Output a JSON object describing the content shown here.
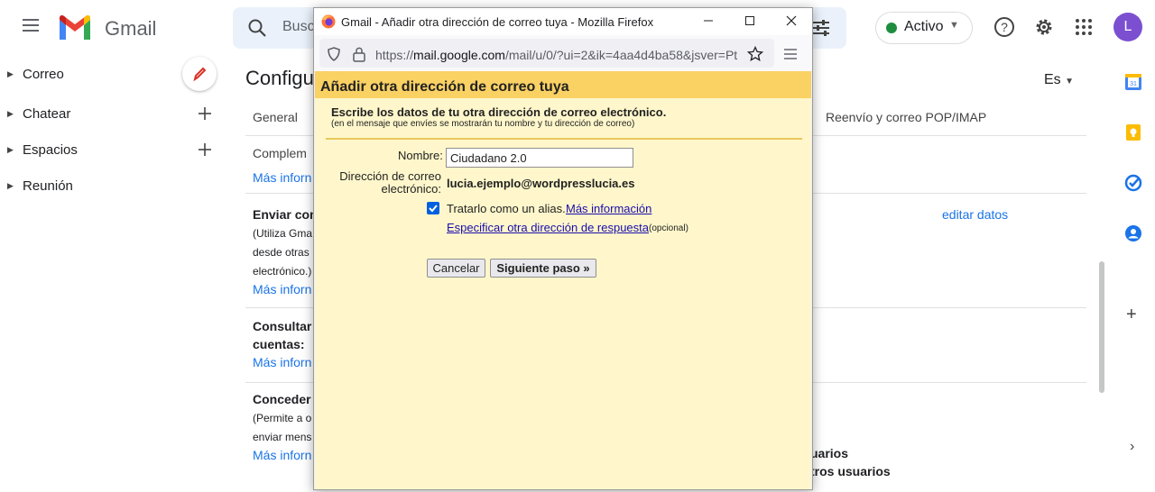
{
  "gmail": {
    "brand": "Gmail",
    "search_placeholder": "Busc",
    "status": "Activo",
    "avatar_letter": "L",
    "nav": [
      "Correo",
      "Chatear",
      "Espacios",
      "Reunión"
    ],
    "settings_title": "Configu",
    "language": "Es",
    "tabs": {
      "general": "General",
      "forwarding": "Reenvío y correo POP/IMAP"
    },
    "rows": {
      "complement": "Complem",
      "more_info_1": "Más inforn",
      "send_title": "Enviar com",
      "send_desc_1": "(Utiliza Gma",
      "send_desc_2": "desde otras",
      "send_desc_3": "electrónico.)",
      "more_info_2": "Más inforn",
      "edit_data": "editar datos",
      "check_title_1": "Consultar",
      "check_title_2": "cuentas:",
      "more_info_3": "Más inforn",
      "grant_title": "Conceder a",
      "grant_desc_1": "(Permite a o",
      "grant_desc_2": "enviar mens",
      "more_info_4": "Más inforn",
      "users_1": "uarios",
      "users_2": "tros usuarios"
    }
  },
  "popup": {
    "window_title": "Gmail - Añadir otra dirección de correo tuya - Mozilla Firefox",
    "url_prefix": "https://",
    "url_host": "mail.google.com",
    "url_rest": "/mail/u/0/?ui=2&ik=4aa4d4ba58&jsver=Pt",
    "header": "Añadir otra dirección de correo tuya",
    "instructions": "Escribe los datos de tu otra dirección de correo electrónico.",
    "instructions_note": "(en el mensaje que envíes se mostrarán tu nombre y tu dirección de correo)",
    "name_label": "Nombre:",
    "name_value": "Ciudadano 2.0",
    "email_label": "Dirección de correo electrónico:",
    "email_value": "lucia.ejemplo@wordpresslucia.es",
    "alias_checked": true,
    "alias_label": "Tratarlo como un alias.",
    "alias_link": "Más información",
    "reply_link": "Especificar otra dirección de respuesta",
    "reply_optional": "(opcional)",
    "cancel_label": "Cancelar",
    "next_label": "Siguiente paso »"
  }
}
